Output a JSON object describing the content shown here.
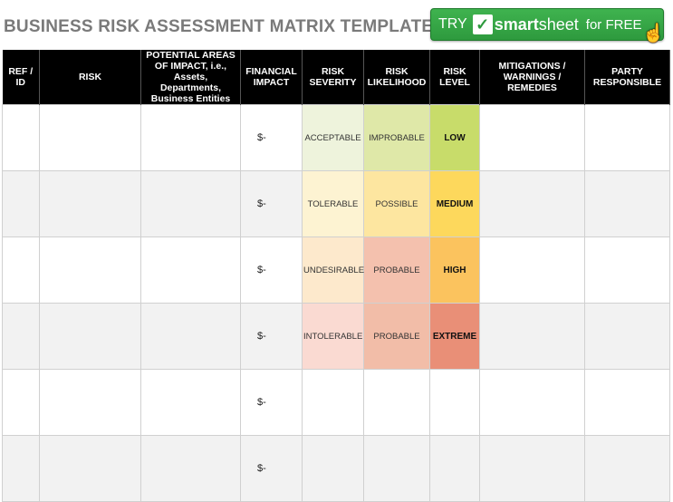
{
  "title": "BUSINESS RISK ASSESSMENT MATRIX TEMPLATE",
  "banner": {
    "try": "TRY",
    "brand_a": "smart",
    "brand_b": "sheet",
    "for_free": "for FREE"
  },
  "headers": [
    "REF / ID",
    "RISK",
    "POTENTIAL AREAS OF IMPACT, i.e., Assets, Departments, Business Entities",
    "FINANCIAL IMPACT",
    "RISK SEVERITY",
    "RISK LIKELIHOOD",
    "RISK LEVEL",
    "MITIGATIONS / WARNINGS / REMEDIES",
    "PARTY RESPONSIBLE"
  ],
  "rows": [
    {
      "ref": "",
      "risk": "",
      "areas": "",
      "financial": "$-",
      "severity": "ACCEPTABLE",
      "likelihood": "IMPROBABLE",
      "level": "LOW",
      "mitigations": "",
      "party": "",
      "colors": {
        "severity": "#eef3dc",
        "likelihood": "#dfe8a8",
        "level": "#c8dc6a"
      }
    },
    {
      "ref": "",
      "risk": "",
      "areas": "",
      "financial": "$-",
      "severity": "TOLERABLE",
      "likelihood": "POSSIBLE",
      "level": "MEDIUM",
      "mitigations": "",
      "party": "",
      "colors": {
        "severity": "#fdf3d2",
        "likelihood": "#fde6a0",
        "level": "#fdd85c"
      }
    },
    {
      "ref": "",
      "risk": "",
      "areas": "",
      "financial": "$-",
      "severity": "UNDESIRABLE",
      "likelihood": "PROBABLE",
      "level": "HIGH",
      "mitigations": "",
      "party": "",
      "colors": {
        "severity": "#fde9cc",
        "likelihood": "#f4c1ae",
        "level": "#fbc35e"
      }
    },
    {
      "ref": "",
      "risk": "",
      "areas": "",
      "financial": "$-",
      "severity": "INTOLERABLE",
      "likelihood": "PROBABLE",
      "level": "EXTREME",
      "mitigations": "",
      "party": "",
      "colors": {
        "severity": "#fadad2",
        "likelihood": "#f2bda8",
        "level": "#e98f77"
      }
    },
    {
      "ref": "",
      "risk": "",
      "areas": "",
      "financial": "$-",
      "severity": "",
      "likelihood": "",
      "level": "",
      "mitigations": "",
      "party": "",
      "colors": {
        "severity": "",
        "likelihood": "",
        "level": ""
      }
    },
    {
      "ref": "",
      "risk": "",
      "areas": "",
      "financial": "$-",
      "severity": "",
      "likelihood": "",
      "level": "",
      "mitigations": "",
      "party": "",
      "colors": {
        "severity": "",
        "likelihood": "",
        "level": ""
      }
    }
  ]
}
